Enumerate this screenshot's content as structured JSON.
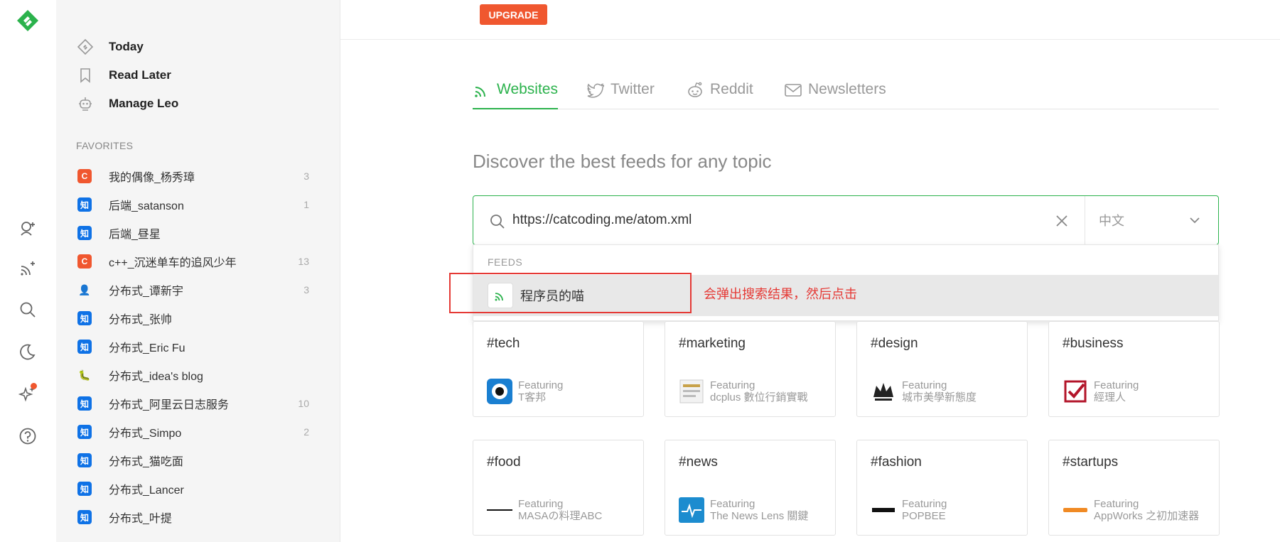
{
  "nav": {
    "today": "Today",
    "read_later": "Read Later",
    "manage": "Manage Leo"
  },
  "favorites": {
    "title": "FAVORITES",
    "items": [
      {
        "icon": "C",
        "type": "c",
        "name": "我的偶像_杨秀璋",
        "count": "3"
      },
      {
        "icon": "知",
        "type": "zhi",
        "name": "后端_satanson",
        "count": "1"
      },
      {
        "icon": "知",
        "type": "zhi",
        "name": "后端_昼星",
        "count": ""
      },
      {
        "icon": "C",
        "type": "c",
        "name": "c++_沉迷单车的追风少年",
        "count": "13"
      },
      {
        "icon": "👤",
        "type": "ghost",
        "name": "分布式_谭新宇",
        "count": "3"
      },
      {
        "icon": "知",
        "type": "zhi",
        "name": "分布式_张帅",
        "count": ""
      },
      {
        "icon": "知",
        "type": "zhi",
        "name": "分布式_Eric Fu",
        "count": ""
      },
      {
        "icon": "🐛",
        "type": "bug",
        "name": "分布式_idea's blog",
        "count": ""
      },
      {
        "icon": "知",
        "type": "zhi",
        "name": "分布式_阿里云日志服务",
        "count": "10"
      },
      {
        "icon": "知",
        "type": "zhi",
        "name": "分布式_Simpo",
        "count": "2"
      },
      {
        "icon": "知",
        "type": "zhi",
        "name": "分布式_猫吃面",
        "count": ""
      },
      {
        "icon": "知",
        "type": "zhi",
        "name": "分布式_Lancer",
        "count": ""
      },
      {
        "icon": "知",
        "type": "zhi",
        "name": "分布式_叶提",
        "count": ""
      }
    ]
  },
  "topbar": {
    "upgrade": "UPGRADE"
  },
  "tabs": [
    {
      "label": "Websites",
      "active": true
    },
    {
      "label": "Twitter",
      "active": false
    },
    {
      "label": "Reddit",
      "active": false
    },
    {
      "label": "Newsletters",
      "active": false
    }
  ],
  "discover": "Discover the best feeds for any topic",
  "search": {
    "value": "https://catcoding.me/atom.xml",
    "language": "中文"
  },
  "dropdown": {
    "title": "FEEDS",
    "result_name": "程序员的喵"
  },
  "annotation": "会弹出搜索结果，然后点击",
  "cards": [
    {
      "tag": "#tech",
      "featuring": "Featuring",
      "source": "T客邦"
    },
    {
      "tag": "#marketing",
      "featuring": "Featuring",
      "source": "dcplus 數位行銷實戰"
    },
    {
      "tag": "#design",
      "featuring": "Featuring",
      "source": "城市美學新態度"
    },
    {
      "tag": "#business",
      "featuring": "Featuring",
      "source": "經理人"
    },
    {
      "tag": "#food",
      "featuring": "Featuring",
      "source": "MASAの料理ABC"
    },
    {
      "tag": "#news",
      "featuring": "Featuring",
      "source": "The News Lens 關鍵"
    },
    {
      "tag": "#fashion",
      "featuring": "Featuring",
      "source": "POPBEE"
    },
    {
      "tag": "#startups",
      "featuring": "Featuring",
      "source": "AppWorks 之初加速器"
    }
  ],
  "colors": {
    "brand_green": "#2bb24c",
    "upgrade_orange": "#f0572f",
    "zhihu_blue": "#0f72e6",
    "annotation_red": "#e53935"
  }
}
